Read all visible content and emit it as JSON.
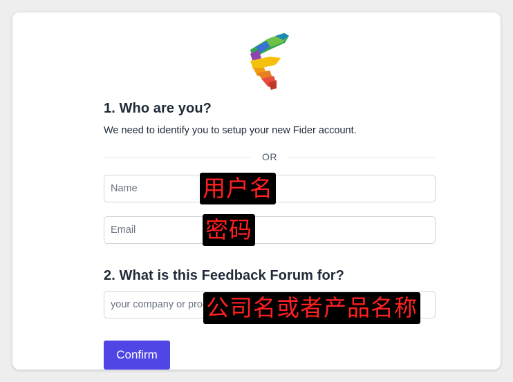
{
  "brand": {
    "logo_icon": "fider-logo-icon"
  },
  "step1": {
    "title": "1. Who are you?",
    "subtitle": "We need to identify you to setup your new Fider account.",
    "divider_text": "OR",
    "name_placeholder": "Name",
    "name_annotation": "用户名",
    "email_placeholder": "Email",
    "email_annotation": "密码"
  },
  "step2": {
    "title": "2. What is this Feedback Forum for?",
    "company_placeholder": "your company or product name",
    "company_annotation": "公司名或者产品名称"
  },
  "actions": {
    "confirm_label": "Confirm"
  },
  "colors": {
    "primary_button": "#4f46e5",
    "annotation_background": "#000000",
    "annotation_text": "#ff2020"
  }
}
